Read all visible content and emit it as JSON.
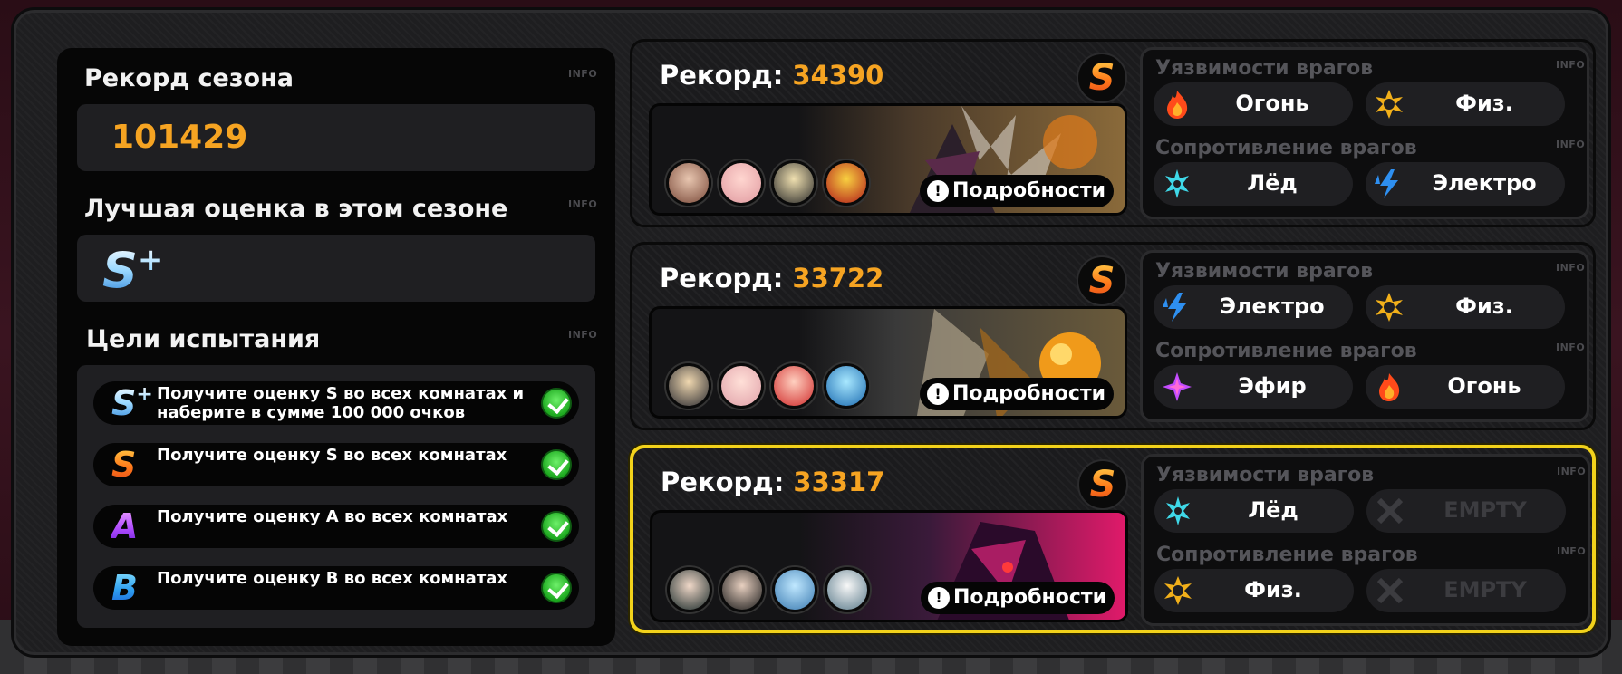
{
  "info_label": "INFO",
  "season": {
    "record_title": "Рекорд сезона",
    "record_value": "101429",
    "best_title": "Лучшая оценка в этом сезоне",
    "best_grade": "S",
    "goals_title": "Цели испытания"
  },
  "goals": [
    {
      "grade": "S",
      "plus": "+",
      "text": "Получите оценку S во всех комнатах и наберите в сумме 100 000 очков"
    },
    {
      "grade": "S",
      "plus": "",
      "text": "Получите оценку S во всех комнатах"
    },
    {
      "grade": "A",
      "plus": "",
      "text": "Получите оценку А во всех комнатах"
    },
    {
      "grade": "B",
      "plus": "",
      "text": "Получите оценку B во всех комнатах"
    }
  ],
  "rooms": [
    {
      "record_label": "Рекорд:",
      "record_value": "34390",
      "grade": "S",
      "details": "Подробности",
      "weak_title": "Уязвимости врагов",
      "resist_title": "Сопротивление врагов",
      "weak": [
        {
          "label": "Огонь",
          "icon": "fire-icon"
        },
        {
          "label": "Физ.",
          "icon": "physical-icon"
        }
      ],
      "resist": [
        {
          "label": "Лёд",
          "icon": "ice-icon"
        },
        {
          "label": "Электро",
          "icon": "electro-icon"
        }
      ]
    },
    {
      "record_label": "Рекорд:",
      "record_value": "33722",
      "grade": "S",
      "details": "Подробности",
      "weak_title": "Уязвимости врагов",
      "resist_title": "Сопротивление врагов",
      "weak": [
        {
          "label": "Электро",
          "icon": "electro-icon"
        },
        {
          "label": "Физ.",
          "icon": "physical-icon"
        }
      ],
      "resist": [
        {
          "label": "Эфир",
          "icon": "ether-icon"
        },
        {
          "label": "Огонь",
          "icon": "fire-icon"
        }
      ]
    },
    {
      "record_label": "Рекорд:",
      "record_value": "33317",
      "grade": "S",
      "details": "Подробности",
      "weak_title": "Уязвимости врагов",
      "resist_title": "Сопротивление врагов",
      "weak": [
        {
          "label": "Лёд",
          "icon": "ice-icon"
        },
        {
          "label": "EMPTY",
          "icon": "empty-x-icon"
        }
      ],
      "resist": [
        {
          "label": "Физ.",
          "icon": "physical-icon"
        },
        {
          "label": "EMPTY",
          "icon": "empty-x-icon"
        }
      ]
    }
  ],
  "colors": {
    "accent_orange": "#f6a422",
    "selected_border": "#f2d21b",
    "fire": "#ff4a1a",
    "physical": "#f2b01a",
    "ice": "#3fd8e8",
    "electro": "#2e8ff0",
    "ether": "#c24cff"
  }
}
